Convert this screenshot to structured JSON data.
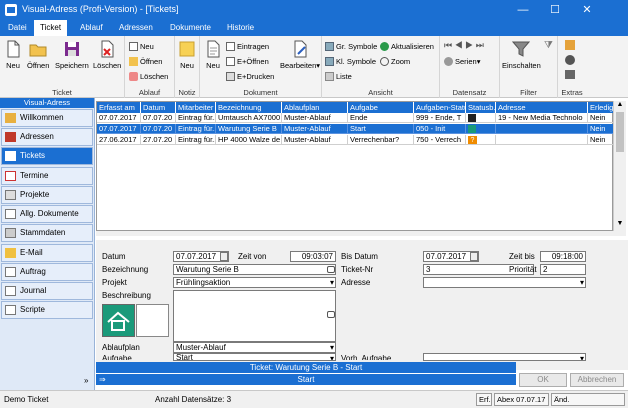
{
  "window": {
    "title": "Visual-Adress (Profi-Version) - [Tickets]",
    "minimize": "—",
    "maximize": "☐",
    "close": "✕"
  },
  "menu": [
    "Datei",
    "Ticket",
    "Ablauf",
    "Adressen",
    "Dokumente",
    "Historie"
  ],
  "ribbon": {
    "ticket": {
      "label": "Ticket",
      "buttons": [
        "Neu",
        "Öffnen",
        "Speichern",
        "Löschen"
      ]
    },
    "ablauf": {
      "label": "Ablauf",
      "items": [
        "Neu",
        "Öffnen",
        "Löschen"
      ]
    },
    "notiz": {
      "label": "Notiz",
      "new": "Neu"
    },
    "dokument": {
      "label": "Dokument",
      "new": "Neu",
      "items": [
        "Eintragen",
        "E+Öffnen",
        "E+Drucken"
      ],
      "edit": "Bearbeiten"
    },
    "ansicht": {
      "label": "Ansicht",
      "items": [
        "Gr. Symbole",
        "Aktualisieren",
        "Kl. Symbole",
        "Zoom",
        "Liste"
      ]
    },
    "datensatz": {
      "label": "Datensatz",
      "serien": "Serien"
    },
    "filter": {
      "label": "Filter",
      "button": "Einschalten"
    },
    "extras": {
      "label": "Extras"
    }
  },
  "nav": {
    "header": "Visual-Adress",
    "items": [
      "Willkommen",
      "Adressen",
      "Tickets",
      "Termine",
      "Projekte",
      "Allg. Dokumente",
      "Stammdaten",
      "E-Mail",
      "Auftrag",
      "Journal",
      "Scripte"
    ]
  },
  "grid": {
    "columns": [
      "Erfasst am",
      "Datum",
      "Mitarbeiter",
      "Bezeichnung",
      "Ablaufplan",
      "Aufgabe",
      "Aufgaben-Status",
      "Statusb.",
      "Adresse",
      "Erledigt"
    ],
    "rows": [
      [
        "07.07.2017",
        "07.07.20",
        "Eintrag für..",
        "Umtausch AX7000",
        "Muster-Ablauf",
        "Ende",
        "999 - Ende, T",
        "",
        "19 - New Media Technolo",
        "Nein"
      ],
      [
        "07.07.2017",
        "07.07.20",
        "Eintrag für..",
        "Warutung Serie B",
        "Muster-Ablauf",
        "Start",
        "050 - Init",
        "",
        "",
        "Nein"
      ],
      [
        "27.06.2017",
        "27.07.20",
        "Eintrag für..",
        "HP 4000 Walze de",
        "Muster-Ablauf",
        "Verrechenbar?",
        "750 - Verrech",
        "?",
        "",
        "Nein"
      ]
    ]
  },
  "detail": {
    "datum_label": "Datum",
    "datum": "07.07.2017",
    "zeit_von_label": "Zeit von",
    "zeit_von": "09:03:07",
    "bis_datum_label": "Bis Datum",
    "bis_datum": "07.07.2017",
    "zeit_bis_label": "Zeit bis",
    "zeit_bis": "09:18:00",
    "bezeichnung_label": "Bezeichnung",
    "bezeichnung": "Warutung Serie B",
    "ticket_nr_label": "Ticket-Nr",
    "ticket_nr": "3",
    "prioritaet_label": "Priorität",
    "prioritaet": "2",
    "projekt_label": "Projekt",
    "projekt": "Frühlingsaktion",
    "adresse_label": "Adresse",
    "adresse": "",
    "beschreibung_label": "Beschreibung",
    "beschreibung": "",
    "ablaufplan_label": "Ablaufplan",
    "ablaufplan": "Muster-Ablauf",
    "aufgabe_label": "Aufgabe",
    "aufgabe": "Start",
    "vorh_aufgabe_label": "Vorh. Aufgabe",
    "vorh_aufgabe": ""
  },
  "taskbar": {
    "line1": "Ticket: Warutung Serie B - Start",
    "line2": "Start"
  },
  "buttons": {
    "ok": "OK",
    "cancel": "Abbrechen"
  },
  "status": {
    "left": "Demo Ticket",
    "count": "Anzahl Datensätze: 3",
    "erf_label": "Erf.",
    "erf": "Abex 07.07.17",
    "aend_label": "Änd."
  }
}
